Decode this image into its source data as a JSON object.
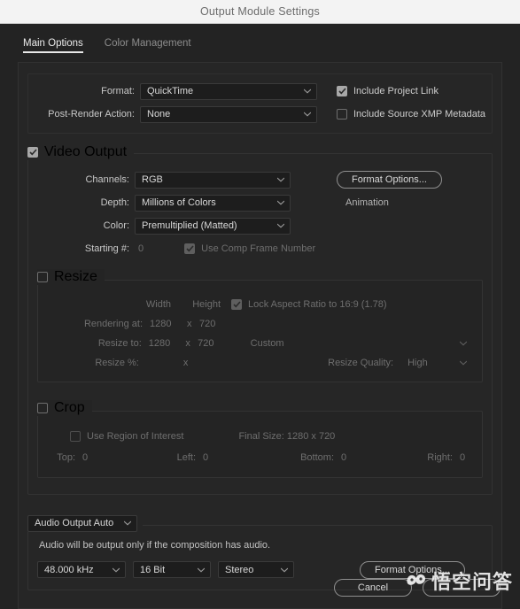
{
  "window": {
    "title": "Output Module Settings"
  },
  "tabs": [
    {
      "label": "Main Options",
      "active": true
    },
    {
      "label": "Color Management",
      "active": false
    }
  ],
  "format_section": {
    "format_label": "Format:",
    "format_value": "QuickTime",
    "post_render_label": "Post-Render Action:",
    "post_render_value": "None",
    "include_project_link_label": "Include Project Link",
    "include_project_link_checked": true,
    "include_xmp_label": "Include Source XMP Metadata",
    "include_xmp_checked": false
  },
  "video_output": {
    "legend": "Video Output",
    "legend_checked": true,
    "channels_label": "Channels:",
    "channels_value": "RGB",
    "depth_label": "Depth:",
    "depth_value": "Millions of Colors",
    "color_label": "Color:",
    "color_value": "Premultiplied (Matted)",
    "starting_label": "Starting #:",
    "starting_value": "0",
    "use_comp_frame_label": "Use Comp Frame Number",
    "use_comp_frame_checked": true,
    "format_options_label": "Format Options...",
    "codec_name": "Animation"
  },
  "resize": {
    "legend": "Resize",
    "legend_checked": false,
    "width_header": "Width",
    "height_header": "Height",
    "lock_aspect_label": "Lock Aspect Ratio to 16:9 (1.78)",
    "lock_aspect_checked": true,
    "rendering_at_label": "Rendering at:",
    "rendering_width": "1280",
    "rendering_x": "x",
    "rendering_height": "720",
    "resize_to_label": "Resize to:",
    "resize_width": "1280",
    "resize_x": "x",
    "resize_height": "720",
    "resize_preset": "Custom",
    "resize_pct_label": "Resize %:",
    "resize_pct_x": "x",
    "resize_quality_label": "Resize Quality:",
    "resize_quality_value": "High"
  },
  "crop": {
    "legend": "Crop",
    "legend_checked": false,
    "use_roi_label": "Use Region of Interest",
    "use_roi_checked": false,
    "final_size_label": "Final Size: 1280 x 720",
    "top_label": "Top:",
    "top_value": "0",
    "left_label": "Left:",
    "left_value": "0",
    "bottom_label": "Bottom:",
    "bottom_value": "0",
    "right_label": "Right:",
    "right_value": "0"
  },
  "audio": {
    "legend": "Audio Output Auto",
    "note": "Audio will be output only if the composition has audio.",
    "sample_rate": "48.000 kHz",
    "bit_depth": "16 Bit",
    "channels": "Stereo",
    "format_options_label": "Format Options..."
  },
  "footer": {
    "cancel_label": "Cancel"
  },
  "watermark": {
    "text": "悟空问答"
  },
  "colors": {
    "titlebar_bg": "#f3f3f3",
    "window_bg": "#232323",
    "panel_bg": "#262626",
    "input_bg": "#1d1d1d",
    "text": "#cdcdcd",
    "text_dim": "#6e6e6e",
    "accent_underline": "#e8e8e8"
  }
}
